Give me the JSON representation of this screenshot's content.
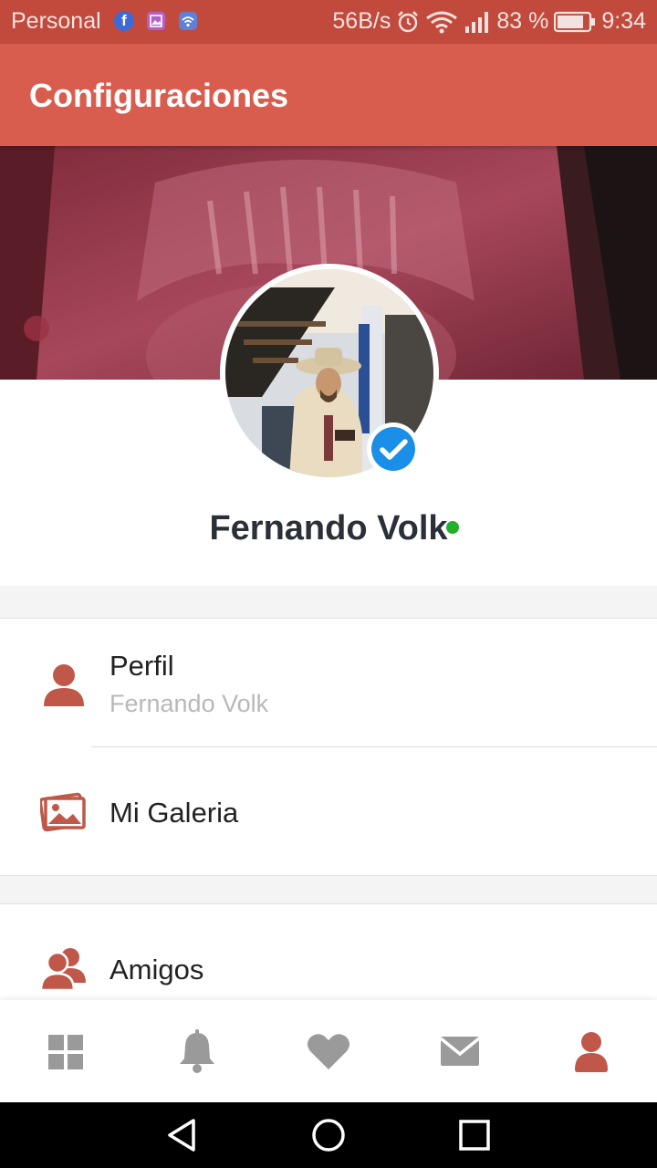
{
  "status_bar": {
    "carrier": "Personal",
    "speed": "56B/s",
    "battery": "83 %",
    "time": "9:34",
    "icons": [
      "facebook-icon",
      "gallery-icon",
      "wifi-app-icon",
      "alarm-icon",
      "wifi-icon",
      "signal-icon",
      "battery-icon"
    ]
  },
  "app_bar": {
    "title": "Configuraciones"
  },
  "profile": {
    "name": "Fernando Volk",
    "verified": true,
    "online": true
  },
  "menu": {
    "items": [
      {
        "title": "Perfil",
        "subtitle": "Fernando Volk",
        "icon": "person-icon"
      },
      {
        "title": "Mi Galeria",
        "icon": "gallery-icon"
      },
      {
        "title": "Amigos",
        "icon": "friends-icon"
      }
    ]
  },
  "bottom_nav": {
    "items": [
      "dashboard-icon",
      "bell-icon",
      "heart-icon",
      "mail-icon",
      "profile-icon"
    ],
    "active": "profile-icon"
  },
  "colors": {
    "status_bar": "#c24a3d",
    "app_bar": "#d95d4e",
    "accent_icon": "#c0584a",
    "inactive_icon": "#9a9a9a",
    "online": "#22b02a",
    "verified": "#1a8fe8"
  }
}
